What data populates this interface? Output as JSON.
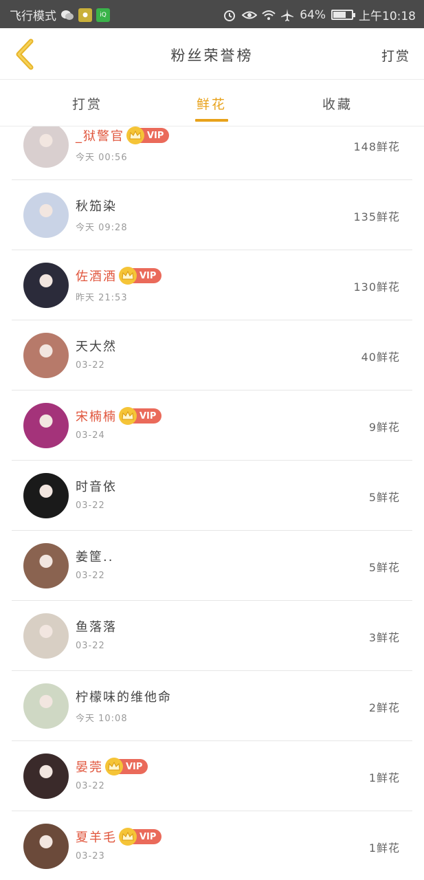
{
  "status_bar": {
    "left_text": "飞行模式",
    "battery_text": "64%",
    "time": "上午10:18",
    "battery_level": 0.64
  },
  "header": {
    "title": "粉丝荣誉榜",
    "right_link": "打赏"
  },
  "tabs": [
    {
      "label": "打赏",
      "active": false
    },
    {
      "label": "鲜花",
      "active": true
    },
    {
      "label": "收藏",
      "active": false
    }
  ],
  "vip_label": "VIP",
  "colors": {
    "accent": "#e8a21b",
    "vip_name": "#e0553c",
    "vip_badge": "#ea6a5a",
    "crown": "#f5c437"
  },
  "rows": [
    {
      "name": "_狱警官",
      "vip": true,
      "time": "今天 00:56",
      "count": "148鲜花",
      "avatar_color": "#d9cfcf"
    },
    {
      "name": "秋笳染",
      "vip": false,
      "time": "今天 09:28",
      "count": "135鲜花",
      "avatar_color": "#c9d3e6"
    },
    {
      "name": "佐酒酒",
      "vip": true,
      "time": "昨天 21:53",
      "count": "130鲜花",
      "avatar_color": "#2b2b3a"
    },
    {
      "name": "天大然",
      "vip": false,
      "time": "03-22",
      "count": "40鲜花",
      "avatar_color": "#b77a6a"
    },
    {
      "name": "宋楠楠",
      "vip": true,
      "time": "03-24",
      "count": "9鲜花",
      "avatar_color": "#a4337a"
    },
    {
      "name": "时音依",
      "vip": false,
      "time": "03-22",
      "count": "5鲜花",
      "avatar_color": "#1a1a1a"
    },
    {
      "name": "姜筐..",
      "vip": false,
      "time": "03-22",
      "count": "5鲜花",
      "avatar_color": "#8a6350"
    },
    {
      "name": "鱼落落",
      "vip": false,
      "time": "03-22",
      "count": "3鲜花",
      "avatar_color": "#d8cfc4"
    },
    {
      "name": "柠檬味的维他命",
      "vip": false,
      "time": "今天 10:08",
      "count": "2鲜花",
      "avatar_color": "#cfd8c4"
    },
    {
      "name": "晏莞",
      "vip": true,
      "time": "03-22",
      "count": "1鲜花",
      "avatar_color": "#3a2a2a"
    },
    {
      "name": "夏羊毛",
      "vip": true,
      "time": "03-23",
      "count": "1鲜花",
      "avatar_color": "#6b4a3a"
    }
  ]
}
